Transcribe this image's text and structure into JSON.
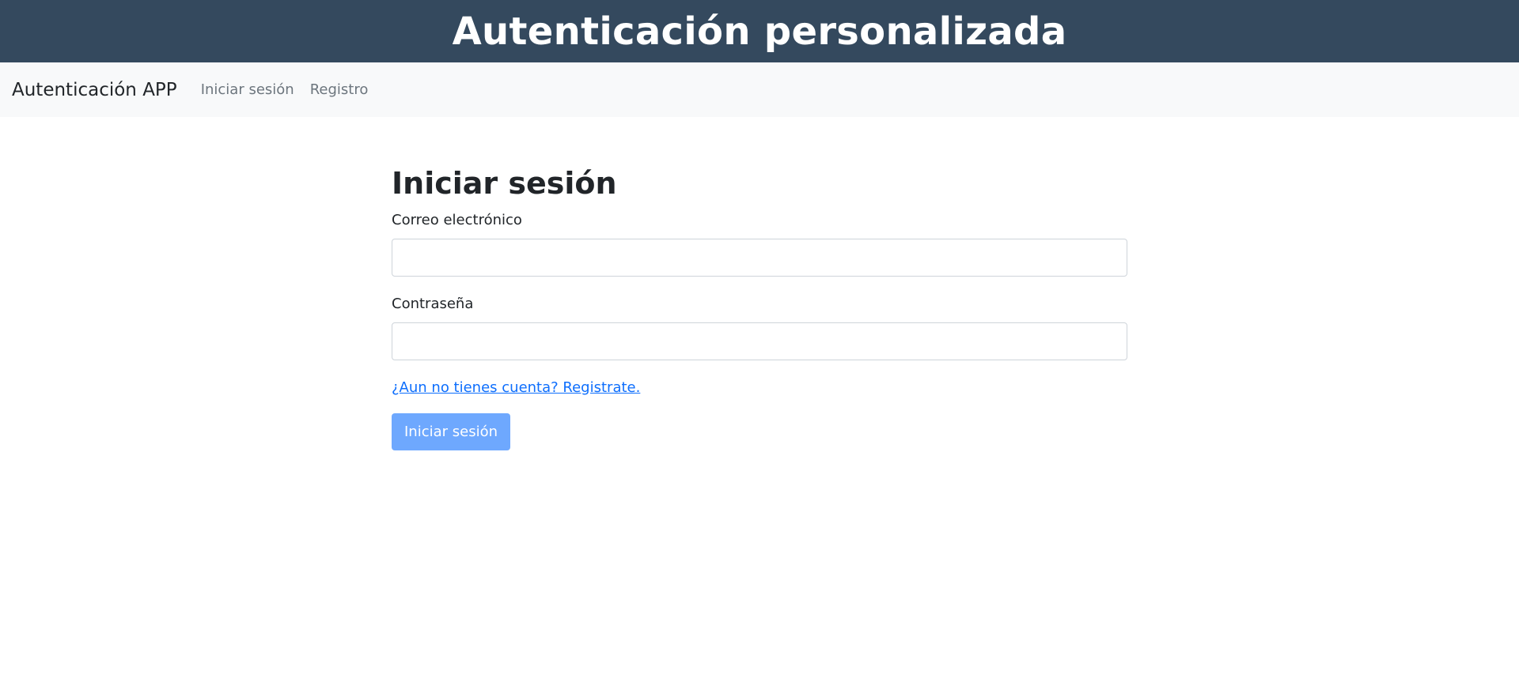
{
  "header": {
    "title": "Autenticación personalizada"
  },
  "navbar": {
    "brand": "Autenticación APP",
    "links": [
      {
        "label": "Iniciar sesión"
      },
      {
        "label": "Registro"
      }
    ]
  },
  "login": {
    "title": "Iniciar sesión",
    "email_label": "Correo electrónico",
    "email_value": "",
    "password_label": "Contraseña",
    "password_value": "",
    "register_link": "¿Aun no tienes cuenta? Registrate.",
    "submit_label": "Iniciar sesión"
  },
  "colors": {
    "header_bg": "#34495e",
    "navbar_bg": "#f8f9fa",
    "link": "#0d6efd",
    "button_bg": "#6ea8fe"
  }
}
